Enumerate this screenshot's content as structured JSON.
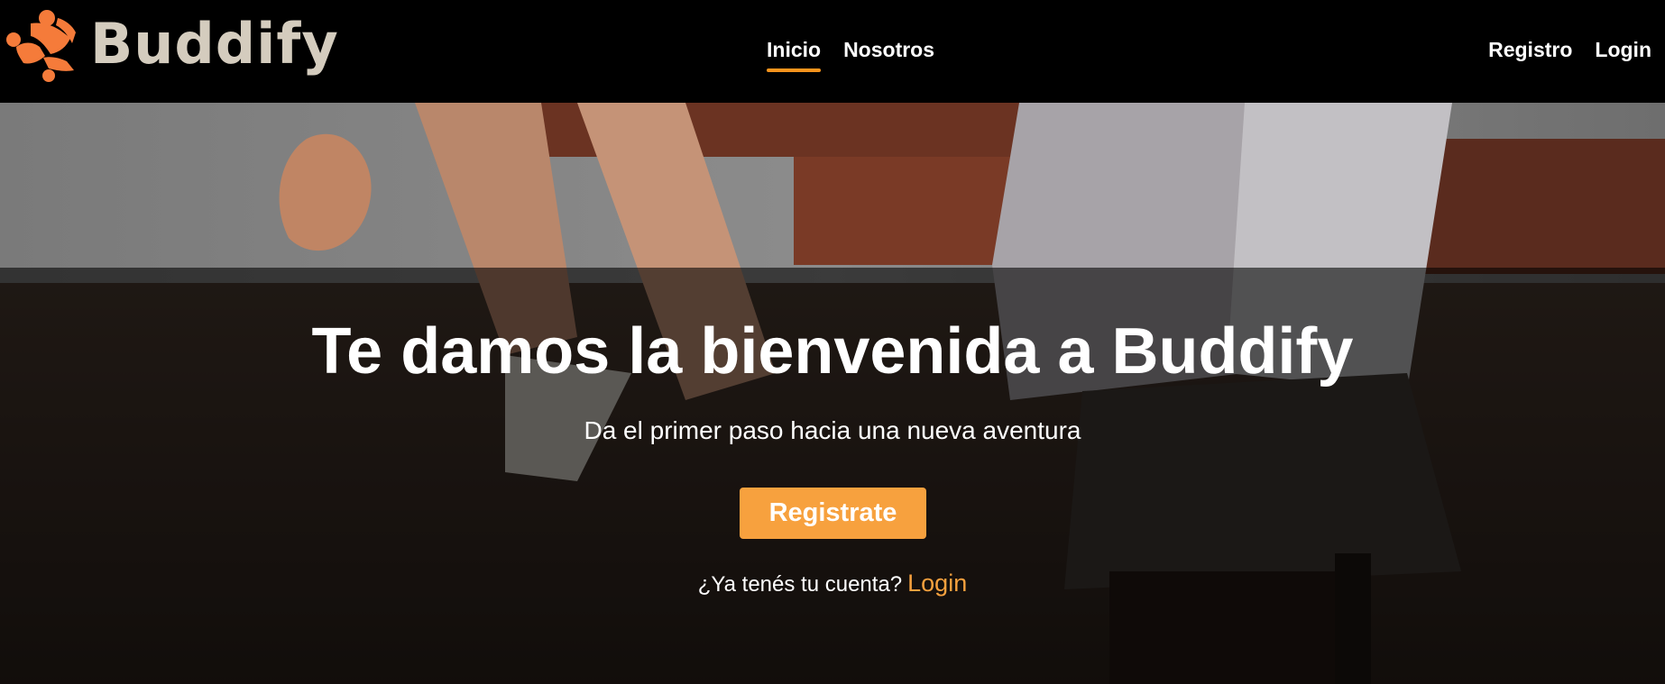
{
  "brand": {
    "name": "Buddify",
    "logo_icon": "buddify-people-logo",
    "colors": {
      "logo_mark": "#f57b3a",
      "wordmark": "#d4ccbe"
    }
  },
  "nav": {
    "center_links": [
      {
        "label": "Inicio",
        "active": true
      },
      {
        "label": "Nosotros",
        "active": false
      }
    ],
    "right_links": [
      {
        "label": "Registro"
      },
      {
        "label": "Login"
      }
    ],
    "active_color": "#f7941d"
  },
  "hero": {
    "background_image": "people sitting on a bench with sandals at sunset",
    "title": "Te damos la bienvenida a Buddify",
    "subtitle": "Da el primer paso hacia una nueva aventura",
    "cta_label": "Registrate",
    "cta_color": "#f7a13e",
    "login_prompt": "¿Ya tenés tu cuenta?",
    "login_link": "Login"
  }
}
